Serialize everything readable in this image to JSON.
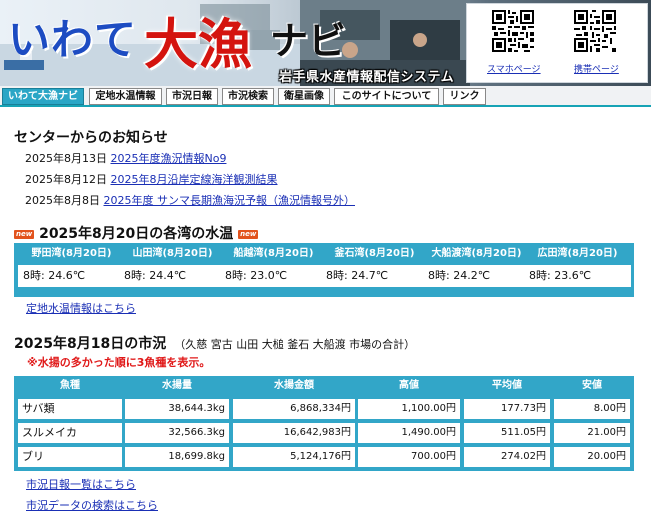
{
  "header": {
    "logo_iwate": "いわて",
    "logo_tairyo": "大漁",
    "logo_navi": "ナビ",
    "system_name": "岩手県水産情報配信システム",
    "qr_smartphone_label": "スマホページ",
    "qr_mobile_label": "携帯ページ"
  },
  "nav": {
    "items": [
      {
        "label": "いわて大漁ナビ",
        "active": true
      },
      {
        "label": "定地水温情報",
        "active": false
      },
      {
        "label": "市況日報",
        "active": false
      },
      {
        "label": "市況検索",
        "active": false
      },
      {
        "label": "衛星画像",
        "active": false
      },
      {
        "label": "このサイトについて",
        "active": false
      },
      {
        "label": "リンク",
        "active": false
      }
    ]
  },
  "notices": {
    "title": "センターからのお知らせ",
    "items": [
      {
        "date": "2025年8月13日",
        "text": "2025年度漁況情報No9"
      },
      {
        "date": "2025年8月12日",
        "text": "2025年8月沿岸定線海洋観測結果"
      },
      {
        "date": "2025年8月8日",
        "text": "2025年度 サンマ長期漁海況予報（漁況情報号外）"
      }
    ]
  },
  "water_temp": {
    "badge_new": "new",
    "title": "2025年8月20日の各湾の水温",
    "stations": [
      {
        "name": "野田湾(8月20日)",
        "value": "8時: 24.6℃"
      },
      {
        "name": "山田湾(8月20日)",
        "value": "8時: 24.4℃"
      },
      {
        "name": "船越湾(8月20日)",
        "value": "8時: 23.0℃"
      },
      {
        "name": "釜石湾(8月20日)",
        "value": "8時: 24.7℃"
      },
      {
        "name": "大船渡湾(8月20日)",
        "value": "8時: 24.2℃"
      },
      {
        "name": "広田湾(8月20日)",
        "value": "8時: 23.6℃"
      }
    ],
    "link": "定地水温情報はこちら"
  },
  "market": {
    "title": "2025年8月18日の市況",
    "subtitle": "（久慈 宮古 山田 大槌 釜石 大船渡 市場の合計）",
    "note": "※水揚の多かった順に3魚種を表示。",
    "columns": [
      "魚種",
      "水揚量",
      "水揚金額",
      "高値",
      "平均値",
      "安値"
    ],
    "rows": [
      [
        "サバ類",
        "38,644.3kg",
        "6,868,334円",
        "1,100.00円",
        "177.73円",
        "8.00円"
      ],
      [
        "スルメイカ",
        "32,566.3kg",
        "16,642,983円",
        "1,490.00円",
        "511.05円",
        "21.00円"
      ],
      [
        "ブリ",
        "18,699.8kg",
        "5,124,176円",
        "700.00円",
        "274.02円",
        "20.00円"
      ]
    ],
    "link_daily": "市況日報一覧はこちら",
    "link_search": "市況データの検索はこちら"
  }
}
